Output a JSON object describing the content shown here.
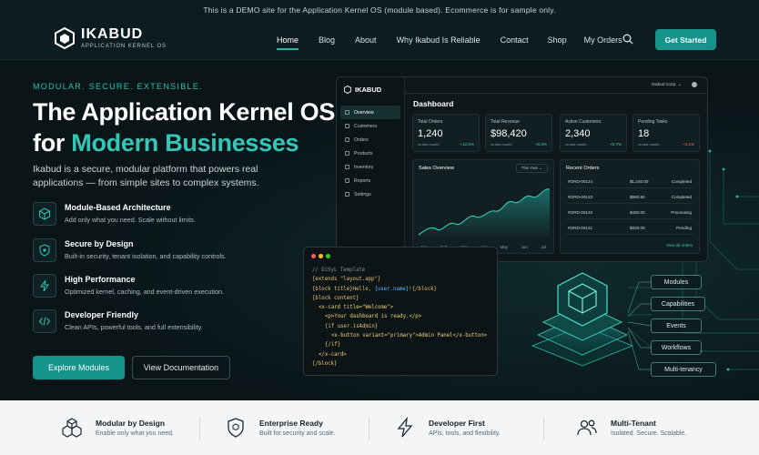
{
  "banner": {
    "text": "This is a DEMO site for the Application Kernel OS (module based). Ecommerce is for sample only."
  },
  "brand": {
    "name": "IKABUD",
    "tagline": "APPLICATION KERNEL OS"
  },
  "nav": {
    "items": [
      {
        "label": "Home",
        "active": true
      },
      {
        "label": "Blog"
      },
      {
        "label": "About"
      },
      {
        "label": "Why Ikabud Is Reliable"
      },
      {
        "label": "Contact"
      },
      {
        "label": "Shop"
      },
      {
        "label": "My Orders"
      }
    ],
    "cta": "Get Started"
  },
  "hero": {
    "eyebrow": "MODULAR. SECURE. EXTENSIBLE.",
    "title_line1": "The Application Kernel OS",
    "title_line2_prefix": "for ",
    "title_line2_accent": "Modern Businesses",
    "lead": "Ikabud is a secure, modular platform that powers real applications — from simple sites to complex systems.",
    "features": [
      {
        "title": "Module-Based Architecture",
        "desc": "Add only what you need. Scale without limits.",
        "icon": "cube-icon"
      },
      {
        "title": "Secure by Design",
        "desc": "Built-in security, tenant isolation, and capability controls.",
        "icon": "shield-icon"
      },
      {
        "title": "High Performance",
        "desc": "Optimized kernel, caching, and event-driven execution.",
        "icon": "lightning-icon"
      },
      {
        "title": "Developer Friendly",
        "desc": "Clean APIs, powerful tools, and full extensibility.",
        "icon": "code-icon"
      }
    ],
    "btn_primary": "Explore Modules",
    "btn_secondary": "View Documentation"
  },
  "dashboard": {
    "brand": "IKABUD",
    "title": "Dashboard",
    "company": "Ikabud Corp. ⌄",
    "sidebar": [
      "Overview",
      "Customers",
      "Orders",
      "Products",
      "Inventory",
      "Reports",
      "Settings"
    ],
    "stats": [
      {
        "label": "Total Orders",
        "value": "1,240",
        "foot": "vs last month",
        "delta": "+12.5%",
        "dir": "pos"
      },
      {
        "label": "Total Revenue",
        "value": "$98,420",
        "foot": "vs last month",
        "delta": "+8.3%",
        "dir": "pos"
      },
      {
        "label": "Active Customers",
        "value": "2,340",
        "foot": "vs last month",
        "delta": "+5.7%",
        "dir": "pos"
      },
      {
        "label": "Pending Tasks",
        "value": "18",
        "foot": "vs last month",
        "delta": "−3.1%",
        "dir": "neg"
      }
    ],
    "sales": {
      "title": "Sales Overview",
      "period": "This Year ⌄",
      "months": [
        "Jan",
        "Feb",
        "Mar",
        "Apr",
        "May",
        "Jun",
        "Jul"
      ]
    },
    "orders": {
      "title": "Recent Orders",
      "rows": [
        {
          "id": "#ORD-00124",
          "amount": "$1,240.00",
          "status": "Completed"
        },
        {
          "id": "#ORD-00123",
          "amount": "$980.50",
          "status": "Completed"
        },
        {
          "id": "#ORD-00122",
          "amount": "$450.00",
          "status": "Processing"
        },
        {
          "id": "#ORD-00121",
          "amount": "$320.00",
          "status": "Pending"
        }
      ],
      "view_all": "View all orders"
    }
  },
  "code": {
    "comment": "// DiSyL Template",
    "l1": "{extends \"layout.app\"}",
    "l2a": "{block title}Hello, ",
    "l2b": "{user.name}",
    "l2c": "!{/block}",
    "l3": "{block content}",
    "l4": "<x-card title=\"Welcome\">",
    "l5": "<p>Your dashboard is ready.</p>",
    "l6": "{if user.isAdmin}",
    "l7": "<x-button variant=\"primary\">Admin Panel</x-button>",
    "l8": "{/if}",
    "l9": "</x-card>",
    "l10": "{/block}"
  },
  "modules": [
    "Modules",
    "Capabilities",
    "Events",
    "Workflows",
    "Multi-tenancy"
  ],
  "bottom": [
    {
      "title": "Modular by Design",
      "desc": "Enable only what you need."
    },
    {
      "title": "Enterprise Ready",
      "desc": "Built for security and scale."
    },
    {
      "title": "Developer First",
      "desc": "APIs, tools, and flexibility."
    },
    {
      "title": "Multi-Tenant",
      "desc": "Isolated. Secure. Scalable."
    }
  ],
  "colors": {
    "accent": "#14948b",
    "accent_text": "#34c6b7",
    "background": "#0b1418"
  }
}
